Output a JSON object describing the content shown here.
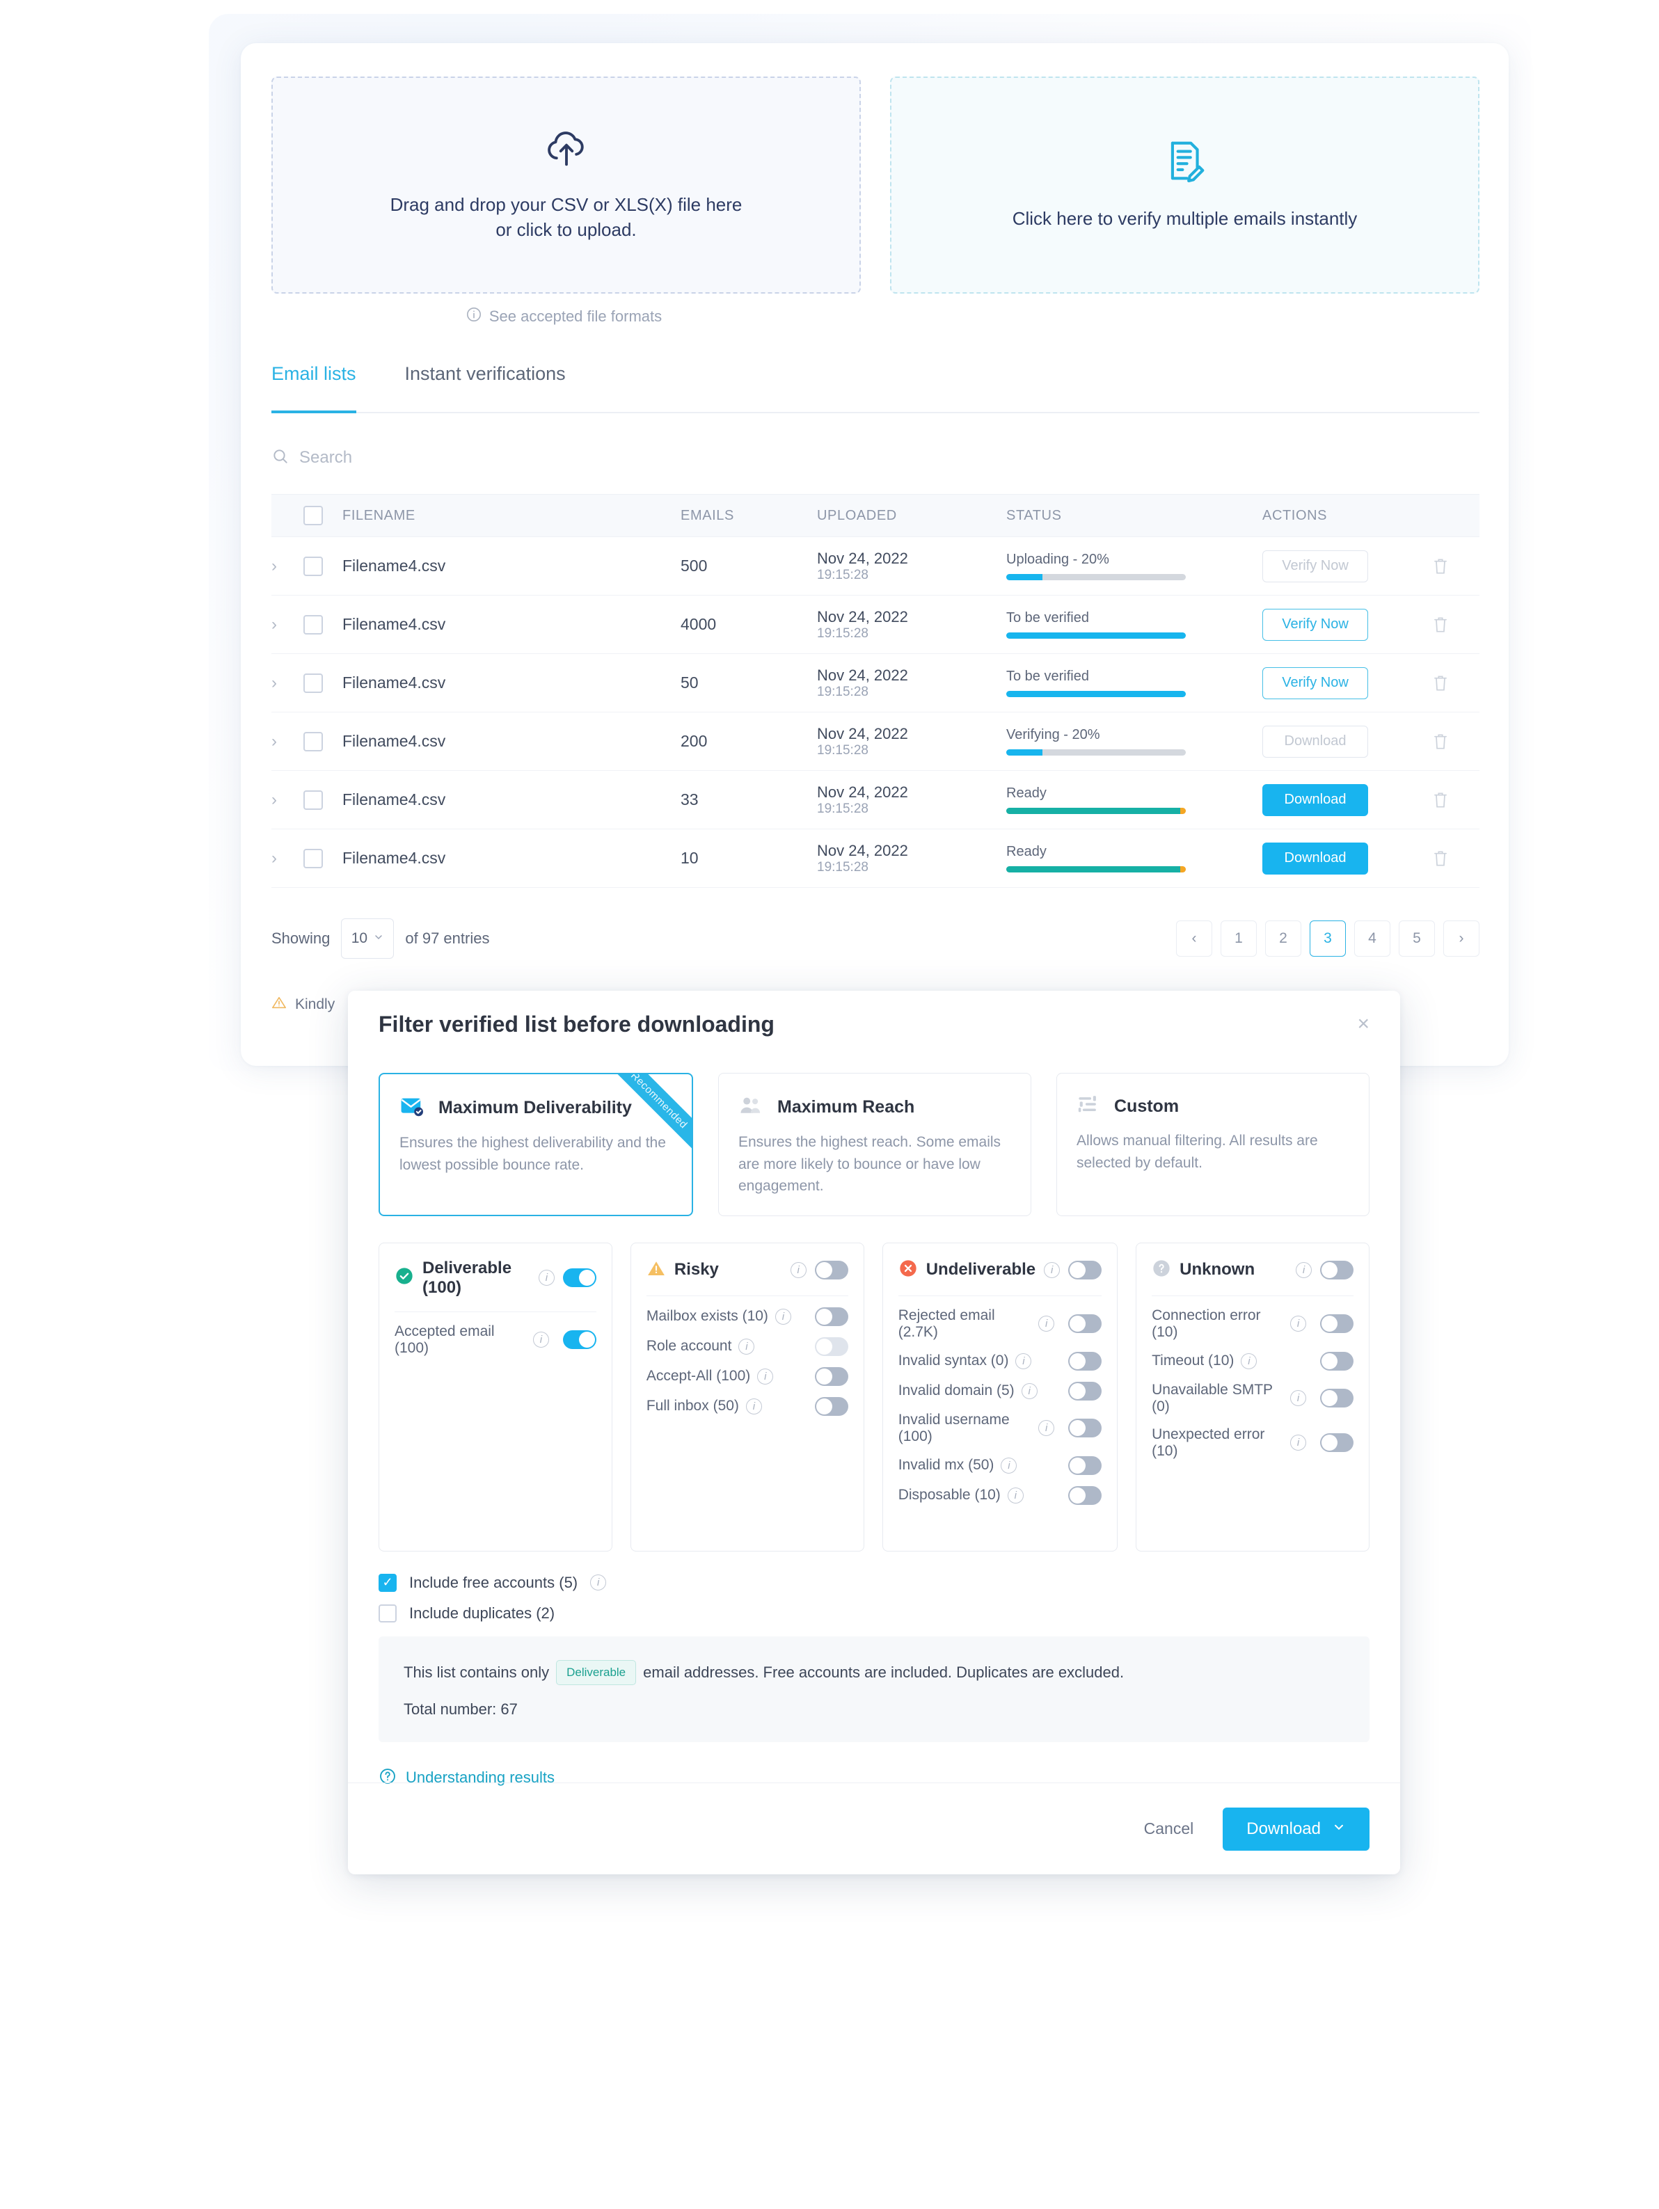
{
  "upload": {
    "left": {
      "icon": "cloud-upload-icon",
      "line1": "Drag and drop your CSV or XLS(X) file here",
      "line2": "or click to upload."
    },
    "right": {
      "icon": "document-edit-icon",
      "text": "Click here to verify multiple emails instantly"
    },
    "formats_label": "See accepted file formats"
  },
  "tabs": [
    {
      "label": "Email lists",
      "active": true
    },
    {
      "label": "Instant verifications",
      "active": false
    }
  ],
  "search": {
    "placeholder": "Search",
    "value": ""
  },
  "table": {
    "columns": [
      "FILENAME",
      "EMAILS",
      "UPLOADED",
      "STATUS",
      "ACTIONS"
    ],
    "rows": [
      {
        "filename": "Filename4.csv",
        "emails": "500",
        "date": "Nov 24, 2022",
        "time": "19:15:28",
        "status": "Uploading - 20%",
        "progress": 20,
        "bar": "blue",
        "action": "Verify Now",
        "action_style": "ghost"
      },
      {
        "filename": "Filename4.csv",
        "emails": "4000",
        "date": "Nov 24, 2022",
        "time": "19:15:28",
        "status": "To be verified",
        "progress": 100,
        "bar": "blue",
        "action": "Verify Now",
        "action_style": "outline"
      },
      {
        "filename": "Filename4.csv",
        "emails": "50",
        "date": "Nov 24, 2022",
        "time": "19:15:28",
        "status": "To be verified",
        "progress": 100,
        "bar": "blue",
        "action": "Verify Now",
        "action_style": "outline"
      },
      {
        "filename": "Filename4.csv",
        "emails": "200",
        "date": "Nov 24, 2022",
        "time": "19:15:28",
        "status": "Verifying - 20%",
        "progress": 20,
        "bar": "blue",
        "action": "Download",
        "action_style": "ghost"
      },
      {
        "filename": "Filename4.csv",
        "emails": "33",
        "date": "Nov 24, 2022",
        "time": "19:15:28",
        "status": "Ready",
        "progress": 97,
        "bar": "teal",
        "action": "Download",
        "action_style": "solid"
      },
      {
        "filename": "Filename4.csv",
        "emails": "10",
        "date": "Nov 24, 2022",
        "time": "19:15:28",
        "status": "Ready",
        "progress": 97,
        "bar": "teal",
        "action": "Download",
        "action_style": "solid"
      }
    ]
  },
  "pagination": {
    "showing_label": "Showing",
    "page_size": "10",
    "entries_label": "of 97 entries",
    "prev": "‹",
    "next": "›",
    "pages": [
      "1",
      "2",
      "3",
      "4",
      "5"
    ],
    "active_page": "3"
  },
  "notice": {
    "text": "Kindly"
  },
  "modal": {
    "title": "Filter verified list before downloading",
    "close": "×",
    "ribbon": "Recommended",
    "options": [
      {
        "icon": "envelope-check-icon",
        "title": "Maximum Deliverability",
        "desc": "Ensures the highest deliverability and the lowest possible bounce rate.",
        "selected": true
      },
      {
        "icon": "people-icon",
        "title": "Maximum Reach",
        "desc": "Ensures the highest reach. Some emails are more likely to bounce or have low engagement.",
        "selected": false
      },
      {
        "icon": "sliders-icon",
        "title": "Custom",
        "desc": "Allows manual filtering. All results are selected by default.",
        "selected": false
      }
    ],
    "filter_columns": [
      {
        "icon": "check-circle-icon",
        "icon_color": "#18b08e",
        "title": "Deliverable (100)",
        "toggle": "on",
        "items": [
          {
            "label": "Accepted email (100)",
            "toggle": "on",
            "info": true
          }
        ]
      },
      {
        "icon": "warning-triangle-icon",
        "icon_color": "#f5bf62",
        "title": "Risky",
        "toggle": "off",
        "items": [
          {
            "label": "Mailbox exists (10)",
            "toggle": "off",
            "info": true
          },
          {
            "label": "Role account",
            "toggle": "light",
            "info": true
          },
          {
            "label": "Accept-All (100)",
            "toggle": "off",
            "info": true
          },
          {
            "label": "Full inbox (50)",
            "toggle": "off",
            "info": true
          }
        ]
      },
      {
        "icon": "x-circle-icon",
        "icon_color": "#f4694c",
        "title": "Undeliverable",
        "toggle": "off",
        "items": [
          {
            "label": "Rejected email (2.7K)",
            "toggle": "off",
            "info": true
          },
          {
            "label": "Invalid syntax (0)",
            "toggle": "off",
            "info": true
          },
          {
            "label": "Invalid domain (5)",
            "toggle": "off",
            "info": true
          },
          {
            "label": "Invalid username (100)",
            "toggle": "off",
            "info": true
          },
          {
            "label": "Invalid mx (50)",
            "toggle": "off",
            "info": true
          },
          {
            "label": "Disposable (10)",
            "toggle": "off",
            "info": true
          }
        ]
      },
      {
        "icon": "question-circle-icon",
        "icon_color": "#ccd2db",
        "title": "Unknown",
        "toggle": "off",
        "items": [
          {
            "label": "Connection error (10)",
            "toggle": "off",
            "info": true
          },
          {
            "label": "Timeout (10)",
            "toggle": "off",
            "info": true
          },
          {
            "label": "Unavailable SMTP (0)",
            "toggle": "off",
            "info": true
          },
          {
            "label": "Unexpected error (10)",
            "toggle": "off",
            "info": true
          }
        ]
      }
    ],
    "include": [
      {
        "label": "Include free accounts (5)",
        "checked": true,
        "info": true
      },
      {
        "label": "Include duplicates (2)",
        "checked": false,
        "info": false
      }
    ],
    "summary": {
      "prefix": "This list contains only",
      "badge": "Deliverable",
      "suffix": "email addresses. Free accounts are included. Duplicates are excluded.",
      "total": "Total number: 67"
    },
    "help_link": "Understanding results",
    "cancel_label": "Cancel",
    "download_label": "Download",
    "download_caret": "⌄"
  },
  "colors": {
    "accent": "#18b4ef",
    "teal": "#16b0a5",
    "orange": "#f5a623",
    "navy": "#2d3b63"
  }
}
